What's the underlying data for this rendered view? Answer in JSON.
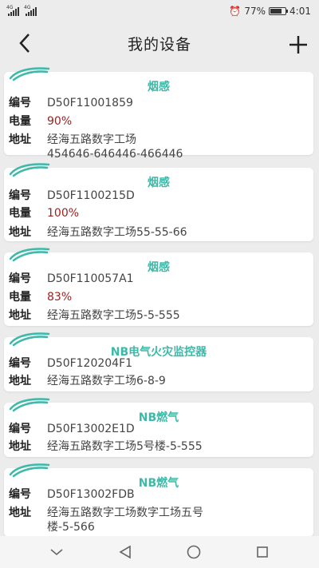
{
  "status_bar": {
    "net1": "4G",
    "net2": "4G",
    "battery_text": "77%",
    "time": "4:01",
    "battery_level": 0.77
  },
  "header": {
    "title": "我的设备"
  },
  "labels": {
    "id": "编号",
    "battery": "电量",
    "address": "地址"
  },
  "devices": [
    {
      "type": "烟感",
      "id": "D50F11001859",
      "battery": "90%",
      "address": "经海五路数字工场\n454646-646446-466446"
    },
    {
      "type": "烟感",
      "id": "D50F1100215D",
      "battery": "100%",
      "address": "经海五路数字工场55-55-66"
    },
    {
      "type": "烟感",
      "id": "D50F110057A1",
      "battery": "83%",
      "address": "经海五路数字工场5-5-555"
    },
    {
      "type": "NB电气火灾监控器",
      "id": "D50F120204F1",
      "address": "经海五路数字工场6-8-9"
    },
    {
      "type": "NB燃气",
      "id": "D50F13002E1D",
      "address": "经海五路数字工场5号楼-5-555"
    },
    {
      "type": "NB燃气",
      "id": "D50F13002FDB",
      "address": "经海五路数字工场数字工场五号\n楼-5-566"
    }
  ],
  "colors": {
    "accent": "#3cb9a8",
    "battery_text": "#a02020"
  }
}
